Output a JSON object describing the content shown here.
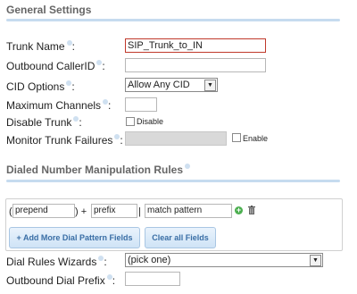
{
  "general": {
    "title": "General Settings"
  },
  "fields": {
    "trunk_name": {
      "label": "Trunk Name",
      "value": "SIP_Trunk_to_IN"
    },
    "outbound_callerid": {
      "label": "Outbound CallerID",
      "value": ""
    },
    "cid_options": {
      "label": "CID Options",
      "value": "Allow Any CID"
    },
    "max_channels": {
      "label": "Maximum Channels",
      "value": ""
    },
    "disable_trunk": {
      "label": "Disable Trunk",
      "checkbox_label": "Disable"
    },
    "monitor_failures": {
      "label": "Monitor Trunk Failures",
      "value": "",
      "checkbox_label": "Enable"
    }
  },
  "dial_rules": {
    "title": "Dialed Number Manipulation Rules",
    "open_paren": "(",
    "prepend_value": "prepend",
    "close_paren_plus": ") +",
    "prefix_value": "prefix",
    "pipe": "|",
    "match_value": "match pattern",
    "add_more_label": "+ Add More Dial Pattern Fields",
    "clear_all_label": "Clear all Fields"
  },
  "wizards": {
    "dial_wizards": {
      "label": "Dial Rules Wizards",
      "value": "(pick one)"
    },
    "outbound_prefix": {
      "label": "Outbound Dial Prefix",
      "value": ""
    }
  },
  "colors": {
    "accent": "#3a6ea5",
    "focus_border": "#c0392b",
    "divider": "#c6dbef"
  }
}
